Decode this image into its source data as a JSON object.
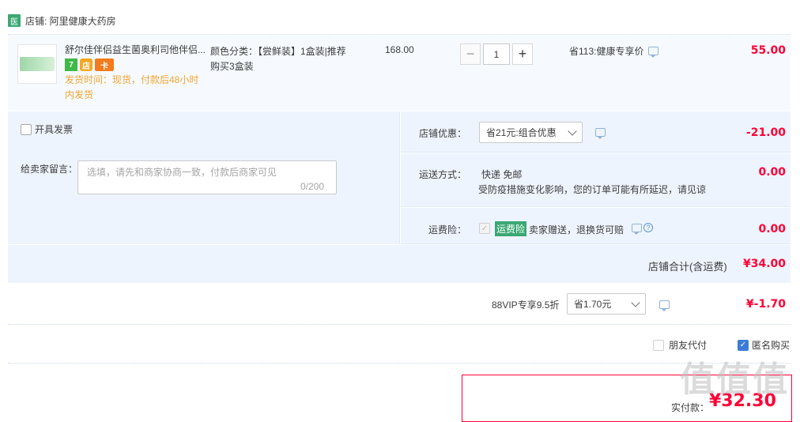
{
  "shop": {
    "badge": "医",
    "name": "店铺: 阿里健康大药房"
  },
  "item": {
    "title": "舒尔佳伴侣益生菌奥利司他伴侣...",
    "delivery": "发货时间：现货，付款后48小时内发货",
    "spec": "颜色分类：【尝鲜装】1盒装|推荐购买3盒装",
    "price": "168.00",
    "quantity": "1",
    "qty_minus": "−",
    "qty_plus": "+",
    "promo": "省113:健康专享价",
    "total": "55.00",
    "badges": [
      "7",
      "店",
      "卡"
    ]
  },
  "invoice": {
    "label": "开具发票"
  },
  "message": {
    "label": "给卖家留言：",
    "placeholder": "选填，请先和商家协商一致，付款后商家可见",
    "count": "0/200"
  },
  "shop_discount": {
    "label": "店铺优惠：",
    "value": "省21元:组合优惠",
    "amount": "-21.00"
  },
  "shipping": {
    "label": "运送方式：",
    "method": "快递 免邮",
    "note": "受防疫措施变化影响，您的订单可能有所延迟，请见谅",
    "amount": "0.00"
  },
  "insurance": {
    "label": "运费险：",
    "tag": "运费险",
    "desc": "卖家赠送，退换货可赔",
    "help": "?",
    "amount": "0.00"
  },
  "subtotal": {
    "label": "店铺合计(含运费)",
    "amount": "¥34.00"
  },
  "vip": {
    "label": "88VIP专享9.5折",
    "value": "省1.70元",
    "amount": "¥-1.70"
  },
  "options": {
    "friend_pay": "朋友代付",
    "anonymous": "匿名购买"
  },
  "payment": {
    "label": "实付款：",
    "amount": "¥32.30"
  },
  "watermark": "值值值"
}
